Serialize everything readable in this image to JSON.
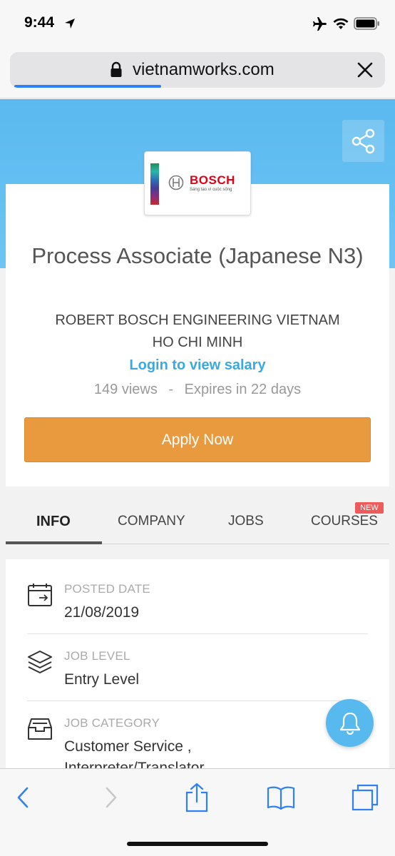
{
  "status_bar": {
    "time": "9:44"
  },
  "browser": {
    "url": "vietnamworks.com",
    "load_progress": 0.4
  },
  "company_logo": {
    "wordmark": "BOSCH",
    "tagline": "Sáng tạo vì cuộc sống"
  },
  "job": {
    "title": "Process Associate (Japanese N3)",
    "company": "ROBERT BOSCH ENGINEERING VIETNAM",
    "location": "HO CHI MINH",
    "salary_link": "Login to view salary",
    "views": "149 views",
    "separator": "-",
    "expires": "Expires in 22 days",
    "apply_label": "Apply Now"
  },
  "tabs": [
    {
      "label": "INFO",
      "active": true
    },
    {
      "label": "COMPANY",
      "active": false
    },
    {
      "label": "JOBS",
      "active": false
    },
    {
      "label": "COURSES",
      "active": false
    }
  ],
  "courses_badge": "NEW",
  "info": [
    {
      "icon": "calendar-icon",
      "label": "POSTED DATE",
      "value": "21/08/2019"
    },
    {
      "icon": "layers-icon",
      "label": "JOB LEVEL",
      "value": "Entry Level"
    },
    {
      "icon": "inbox-icon",
      "label": "JOB CATEGORY",
      "value": "Customer Service ,",
      "value2": "Interpreter/Translator"
    }
  ],
  "colors": {
    "hero": "#5bb9ef",
    "apply": "#ea9a3e",
    "link": "#3ba9e0",
    "badge": "#ef5a5a"
  }
}
